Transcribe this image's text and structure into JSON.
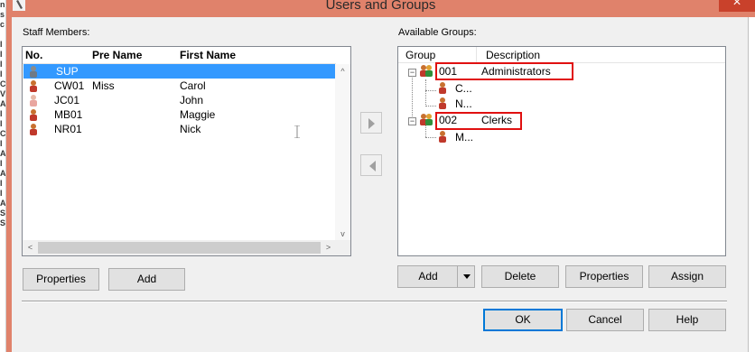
{
  "window": {
    "title": "Users and Groups"
  },
  "staff": {
    "label": "Staff Members:",
    "columns": [
      "No.",
      "Pre Name",
      "First Name"
    ],
    "rows": [
      {
        "no": "SUP",
        "pre": "",
        "first": "",
        "selected": true,
        "icon": "user-gray-icon"
      },
      {
        "no": "CW01",
        "pre": "Miss",
        "first": "Carol",
        "selected": false,
        "icon": "user-red-icon"
      },
      {
        "no": "JC01",
        "pre": "",
        "first": "John",
        "selected": false,
        "icon": "user-faded-icon"
      },
      {
        "no": "MB01",
        "pre": "",
        "first": "Maggie",
        "selected": false,
        "icon": "user-red-icon"
      },
      {
        "no": "NR01",
        "pre": "",
        "first": "Nick",
        "selected": false,
        "icon": "user-red-icon"
      }
    ],
    "buttons": {
      "properties": "Properties",
      "add": "Add"
    }
  },
  "groups": {
    "label": "Available Groups:",
    "columns": [
      "Group",
      "Description"
    ],
    "tree": [
      {
        "code": "001",
        "desc": "Administrators",
        "children": [
          "C...",
          "N..."
        ]
      },
      {
        "code": "002",
        "desc": "Clerks",
        "children": [
          "M..."
        ]
      }
    ],
    "buttons": {
      "add": "Add",
      "delete": "Delete",
      "properties": "Properties",
      "assign": "Assign"
    }
  },
  "footer": {
    "ok": "OK",
    "cancel": "Cancel",
    "help": "Help"
  },
  "colors": {
    "titlebar": "#e0826b",
    "close": "#c9412b",
    "selection": "#3399ff",
    "highlight_box": "#e01010"
  }
}
